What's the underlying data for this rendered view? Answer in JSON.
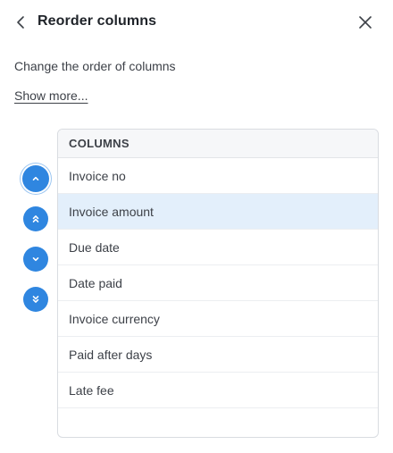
{
  "header": {
    "title": "Reorder columns",
    "back_icon": "chevron-left-icon",
    "close_icon": "close-icon"
  },
  "description": "Change the order of columns",
  "show_more_label": "Show more...",
  "move_controls": [
    {
      "name": "move-up-button",
      "icon": "chevron-up-icon"
    },
    {
      "name": "move-to-top-button",
      "icon": "double-chevron-up-icon"
    },
    {
      "name": "move-down-button",
      "icon": "chevron-down-icon"
    },
    {
      "name": "move-to-bottom-button",
      "icon": "double-chevron-down-icon"
    }
  ],
  "columns": {
    "header": "COLUMNS",
    "items": [
      "Invoice no",
      "Invoice amount",
      "Due date",
      "Date paid",
      "Invoice currency",
      "Paid after days",
      "Late fee"
    ],
    "selected_index": 1
  },
  "colors": {
    "accent": "#2f86e0",
    "selected_row": "#e3effb"
  }
}
